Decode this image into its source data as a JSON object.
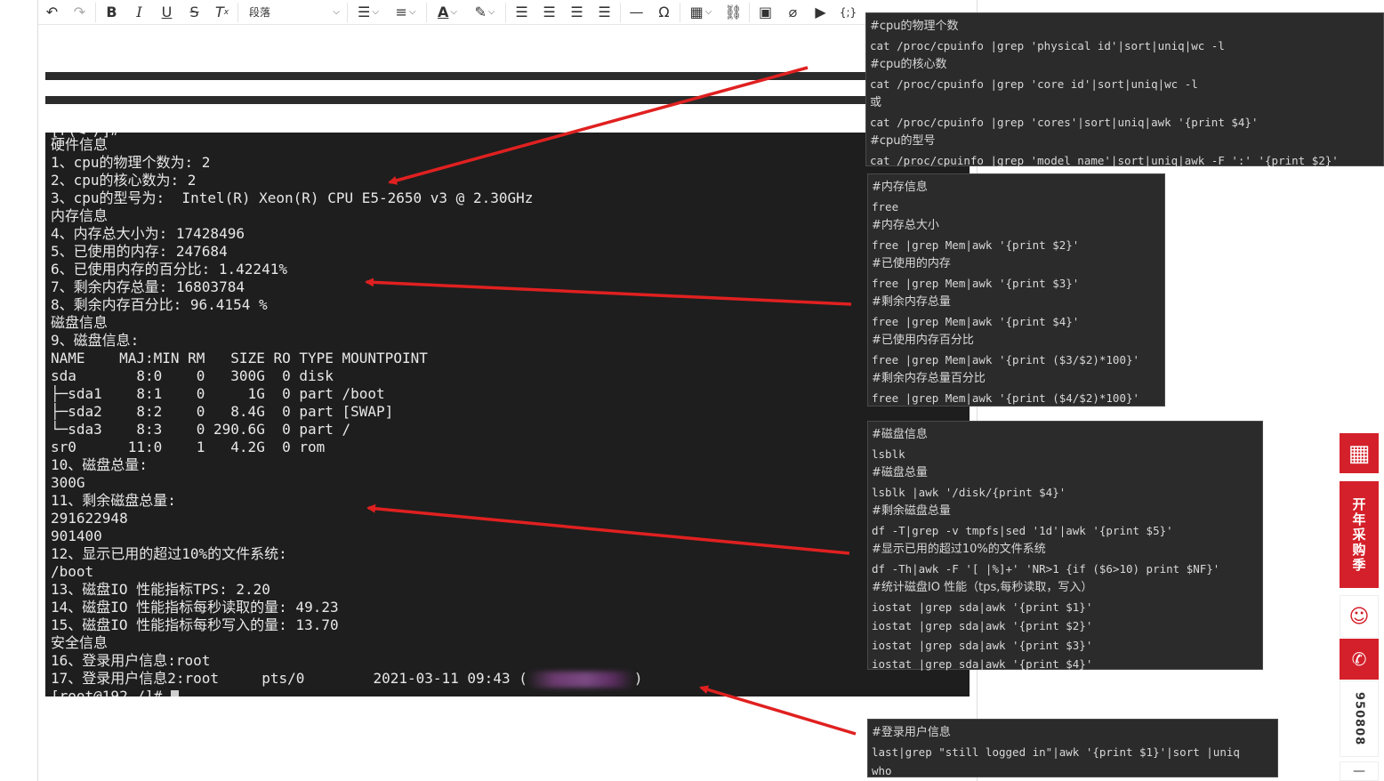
{
  "toolbar": {
    "paragraph_select": "段落",
    "buttons": [
      "undo",
      "redo",
      "bold",
      "italic",
      "underline",
      "strikethrough",
      "clear-format",
      "ordered-list",
      "unordered-list",
      "font-color",
      "highlight",
      "align-left",
      "align-center",
      "align-right",
      "justify",
      "horizontal-rule",
      "special-char",
      "table",
      "link",
      "image",
      "attachment",
      "video",
      "code"
    ]
  },
  "terminal": {
    "lines": [
      "[r(◄ /]#",
      "硬件信息",
      "1、cpu的物理个数为: 2",
      "2、cpu的核心数为: 2",
      "3、cpu的型号为:  Intel(R) Xeon(R) CPU E5-2650 v3 @ 2.30GHz",
      "内存信息",
      "4、内存总大小为: 17428496",
      "5、已使用的内存: 247684",
      "6、已使用内存的百分比: 1.42241%",
      "7、剩余内存总量: 16803784",
      "8、剩余内存百分比: 96.4154 %",
      "磁盘信息",
      "9、磁盘信息:",
      "NAME    MAJ:MIN RM   SIZE RO TYPE MOUNTPOINT",
      "sda       8:0    0   300G  0 disk",
      "├─sda1    8:1    0     1G  0 part /boot",
      "├─sda2    8:2    0   8.4G  0 part [SWAP]",
      "└─sda3    8:3    0 290.6G  0 part /",
      "sr0      11:0    1   4.2G  0 rom",
      "10、磁盘总量:",
      "300G",
      "11、剩余磁盘总量:",
      "291622948",
      "901400",
      "12、显示已用的超过10%的文件系统:",
      "/boot",
      "13、磁盘IO 性能指标TPS: 2.20",
      "14、磁盘IO 性能指标每秒读取的量: 49.23",
      "15、磁盘IO 性能指标每秒写入的量: 13.70",
      "安全信息",
      "16、登录用户信息:root",
      "17、登录用户信息2:root     pts/0        2021-03-11 09:43 (",
      "[root@192 /]# "
    ],
    "line17_close": ")"
  },
  "cpu_box": {
    "lines": [
      "#cpu的物理个数",
      "cat /proc/cpuinfo |grep 'physical id'|sort|uniq|wc -l",
      "#cpu的核心数",
      "cat /proc/cpuinfo |grep 'core id'|sort|uniq|wc -l",
      "或",
      "cat /proc/cpuinfo |grep 'cores'|sort|uniq|awk '{print $4}'",
      "#cpu的型号",
      "cat /proc/cpuinfo |grep 'model name'|sort|uniq|awk -F ':' '{print $2}'"
    ]
  },
  "mem_box": {
    "lines": [
      "#内存信息",
      "free",
      "#内存总大小",
      "free |grep Mem|awk '{print $2}'",
      "#已使用的内存",
      "free |grep Mem|awk '{print $3}'",
      "#剩余内存总量",
      "free |grep Mem|awk '{print $4}'",
      "#已使用内存百分比",
      "free |grep Mem|awk '{print ($3/$2)*100}'",
      "#剩余内存总量百分比",
      "free |grep Mem|awk '{print ($4/$2)*100}'"
    ]
  },
  "disk_box": {
    "lines": [
      "#磁盘信息",
      "lsblk",
      "#磁盘总量",
      "lsblk |awk '/disk/{print $4}'",
      "#剩余磁盘总量",
      "df -T|grep -v tmpfs|sed '1d'|awk '{print $5}'",
      "#显示已用的超过10%的文件系统",
      "df -Th|awk -F '[ |%]+' 'NR>1 {if ($6>10) print $NF}'",
      "#统计磁盘IO 性能（tps,每秒读取，写入）",
      "iostat |grep sda|awk '{print $1}'",
      "iostat |grep sda|awk '{print $2}'",
      "iostat |grep sda|awk '{print $3}'",
      "iostat |grep sda|awk '{print $4}'"
    ]
  },
  "login_box": {
    "lines": [
      "#登录用户信息",
      "last|grep \"still logged in\"|awk '{print $1}'|sort |uniq",
      "who"
    ]
  },
  "side": {
    "promo": "开年采购季",
    "phone_number": "950808"
  },
  "colors": {
    "accent": "#d4202a",
    "arrow": "#e02020",
    "terminal_bg": "#1e1e1e",
    "code_bg": "#2b2b2b"
  }
}
